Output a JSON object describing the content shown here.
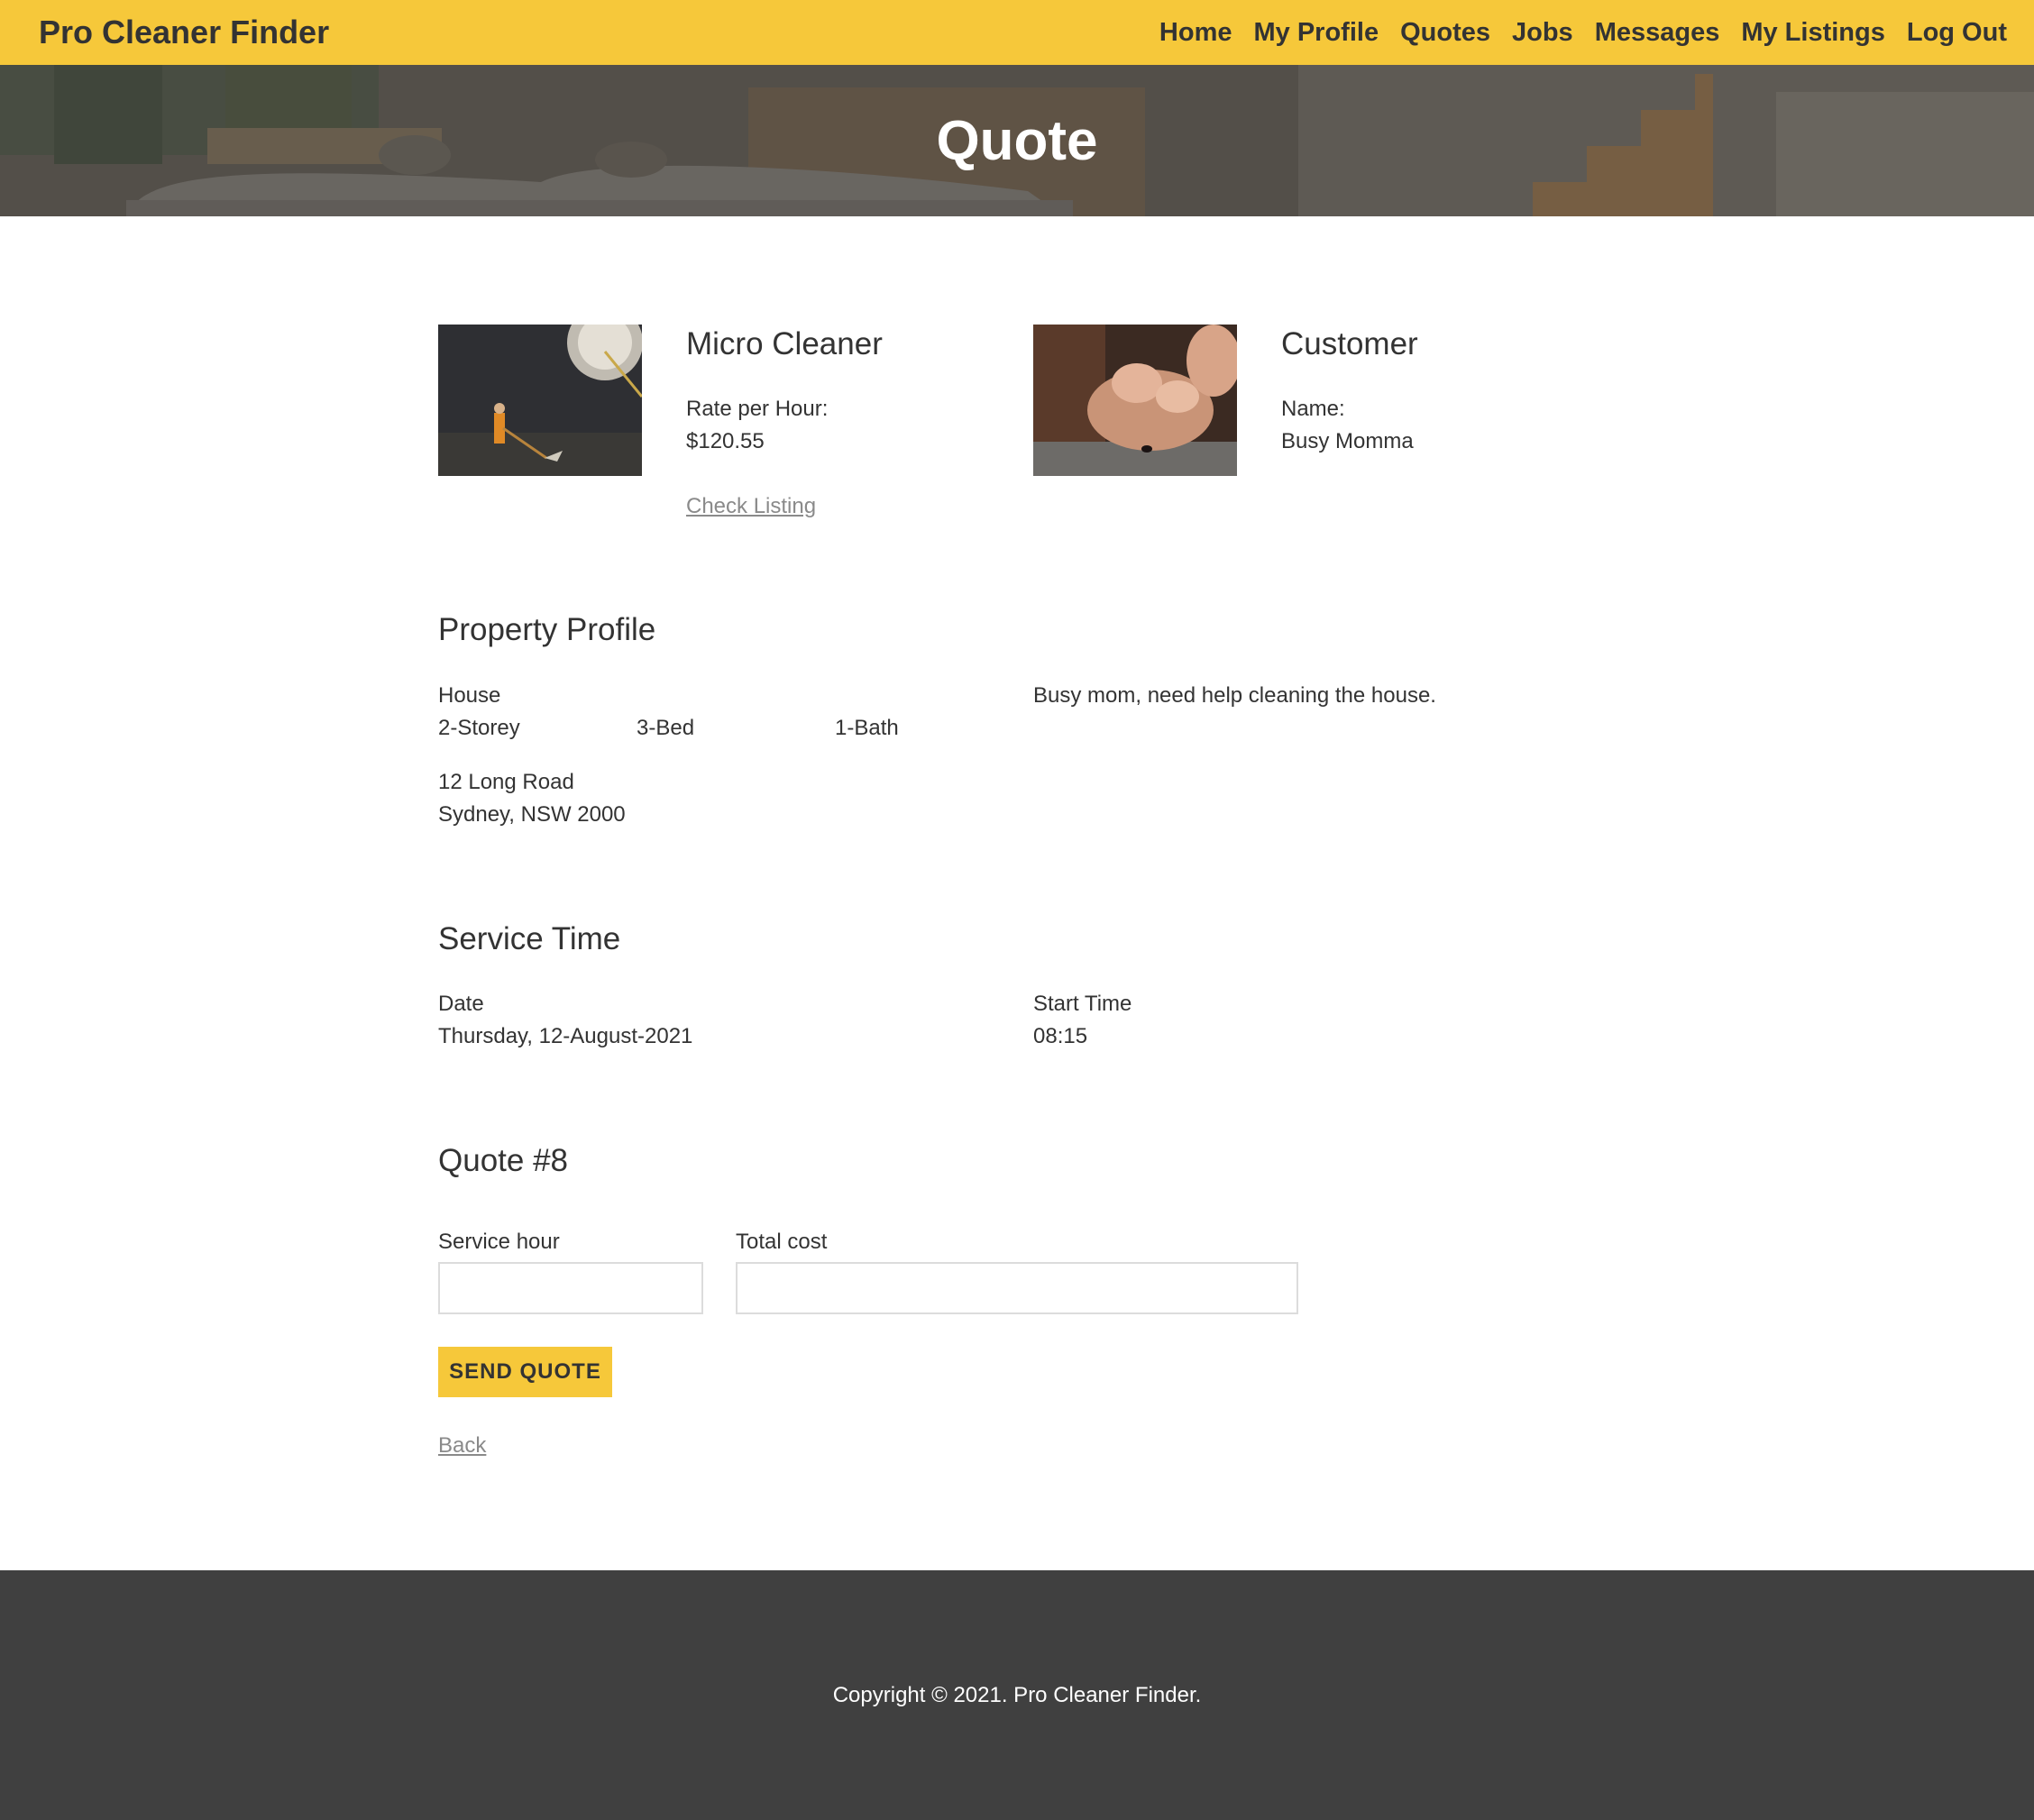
{
  "navbar": {
    "brand": "Pro Cleaner Finder",
    "links": [
      "Home",
      "My Profile",
      "Quotes",
      "Jobs",
      "Messages",
      "My Listings",
      "Log Out"
    ]
  },
  "hero": {
    "title": "Quote"
  },
  "cleaner": {
    "name": "Micro Cleaner",
    "rate_label": "Rate per Hour:",
    "rate_value": "$120.55",
    "check_listing": "Check Listing"
  },
  "customer": {
    "heading": "Customer",
    "name_label": "Name:",
    "name_value": "Busy Momma"
  },
  "property": {
    "heading": "Property Profile",
    "type": "House",
    "storey": "2-Storey",
    "bed": "3-Bed",
    "bath": "1-Bath",
    "address_line1": "12 Long Road",
    "address_line2": "Sydney, NSW 2000",
    "note": "Busy mom, need help cleaning the house."
  },
  "service_time": {
    "heading": "Service Time",
    "date_label": "Date",
    "date_value": "Thursday, 12-August-2021",
    "start_label": "Start Time",
    "start_value": "08:15"
  },
  "quote": {
    "heading": "Quote #8",
    "service_hour_label": "Service hour",
    "service_hour_value": "",
    "total_cost_label": "Total cost",
    "total_cost_value": "",
    "send_button": "SEND QUOTE",
    "back": "Back"
  },
  "footer": {
    "copyright": "Copyright © 2021. Pro Cleaner Finder."
  },
  "colors": {
    "accent": "#f6c83a",
    "footer_bg": "#404040",
    "text": "#333333"
  }
}
